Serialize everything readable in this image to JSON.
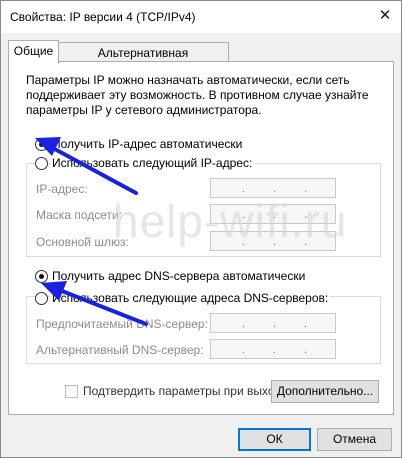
{
  "window": {
    "title": "Свойства: IP версии 4 (TCP/IPv4)",
    "close_glyph": "✕"
  },
  "tabs": [
    {
      "label": "Общие",
      "active": true
    },
    {
      "label": "Альтернативная конфигурация",
      "active": false
    }
  ],
  "description": "Параметры IP можно назначать автоматически, если сеть поддерживает эту возможность. В противном случае узнайте параметры IP у сетевого администратора.",
  "ip_section": {
    "auto_label": "Получить IP-адрес автоматически",
    "manual_label": "Использовать следующий IP-адрес:",
    "selected": "auto",
    "fields": [
      {
        "label": "IP-адрес:",
        "value": ""
      },
      {
        "label": "Маска подсети:",
        "value": ""
      },
      {
        "label": "Основной шлюз:",
        "value": ""
      }
    ]
  },
  "dns_section": {
    "auto_label": "Получить адрес DNS-сервера автоматически",
    "manual_label": "Использовать следующие адреса DNS-серверов:",
    "selected": "auto",
    "fields": [
      {
        "label": "Предпочитаемый DNS-сервер:",
        "value": ""
      },
      {
        "label": "Альтернативный DNS-сервер:",
        "value": ""
      }
    ]
  },
  "validate_checkbox": {
    "label": "Подтвердить параметры при выходе",
    "checked": false
  },
  "buttons": {
    "advanced": "Дополнительно...",
    "ok": "ОК",
    "cancel": "Отмена"
  },
  "watermark": "help-wifi.ru",
  "colors": {
    "annotation_arrow": "#1a22e0",
    "default_button_border": "#0078d7"
  }
}
